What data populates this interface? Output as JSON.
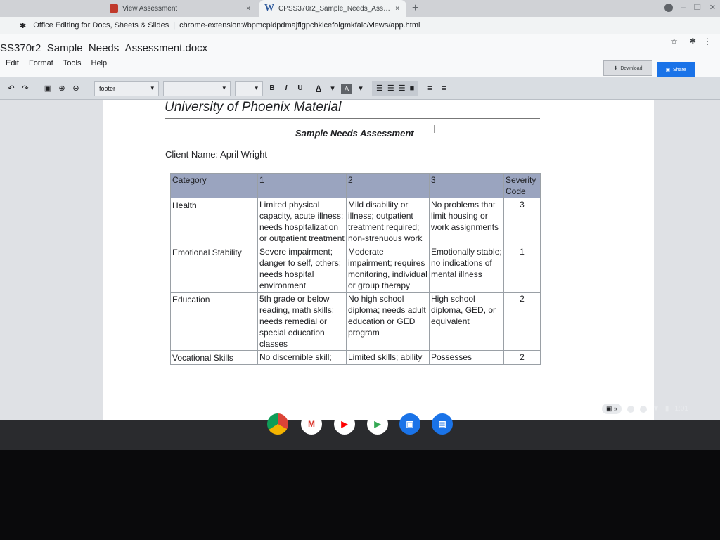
{
  "browser": {
    "tabs": [
      {
        "title": "View Assessment",
        "close": "×"
      },
      {
        "icon": "W",
        "title": "CPSS370r2_Sample_Needs_Ass…",
        "close": "×"
      }
    ],
    "new_tab": "+",
    "app_name": "Office Editing for Docs, Sheets & Slides",
    "url": "chrome-extension://bpmcpldpdmajfigpchkicefoigmkfalc/views/app.html"
  },
  "app": {
    "doc_name": "SS370r2_Sample_Needs_Assessment.docx",
    "menu": [
      "Edit",
      "Format",
      "Tools",
      "Help"
    ],
    "download_label": "Download",
    "share_label": "Share"
  },
  "toolbar": {
    "style_value": "footer",
    "font_value": "",
    "size_value": "",
    "bold": "B",
    "italic": "I",
    "underline": "U",
    "text_color": "A",
    "highlight": "A"
  },
  "document": {
    "header": "University of Phoenix Material",
    "title": "Sample Needs Assessment",
    "client_line": "Client Name: April Wright",
    "table": {
      "headers": [
        "Category",
        "1",
        "2",
        "3",
        "Severity Code"
      ],
      "rows": [
        {
          "category": "Health",
          "c1": "Limited physical capacity, acute illness; needs hospitalization or outpatient treatment",
          "c2": "Mild disability or illness; outpatient treatment required; non-strenuous work",
          "c3": "No problems that limit housing or work assignments",
          "code": "3"
        },
        {
          "category": "Emotional Stability",
          "c1": "Severe impairment; danger to self, others; needs hospital environment",
          "c2": "Moderate impairment; requires monitoring, individual or group therapy",
          "c3": "Emotionally stable; no indications of mental illness",
          "code": "1"
        },
        {
          "category": "Education",
          "c1": "5th grade or below reading, math skills; needs remedial or special education classes",
          "c2": "No high school diploma; needs adult education or GED program",
          "c3": "High school diploma, GED, or equivalent",
          "code": "2"
        },
        {
          "category": "Vocational Skills",
          "c1": "No discernible skill;",
          "c2": "Limited skills; ability",
          "c3": "Possesses",
          "code": "2"
        }
      ]
    }
  },
  "system": {
    "time": "1:01",
    "ime": "▣ »"
  }
}
